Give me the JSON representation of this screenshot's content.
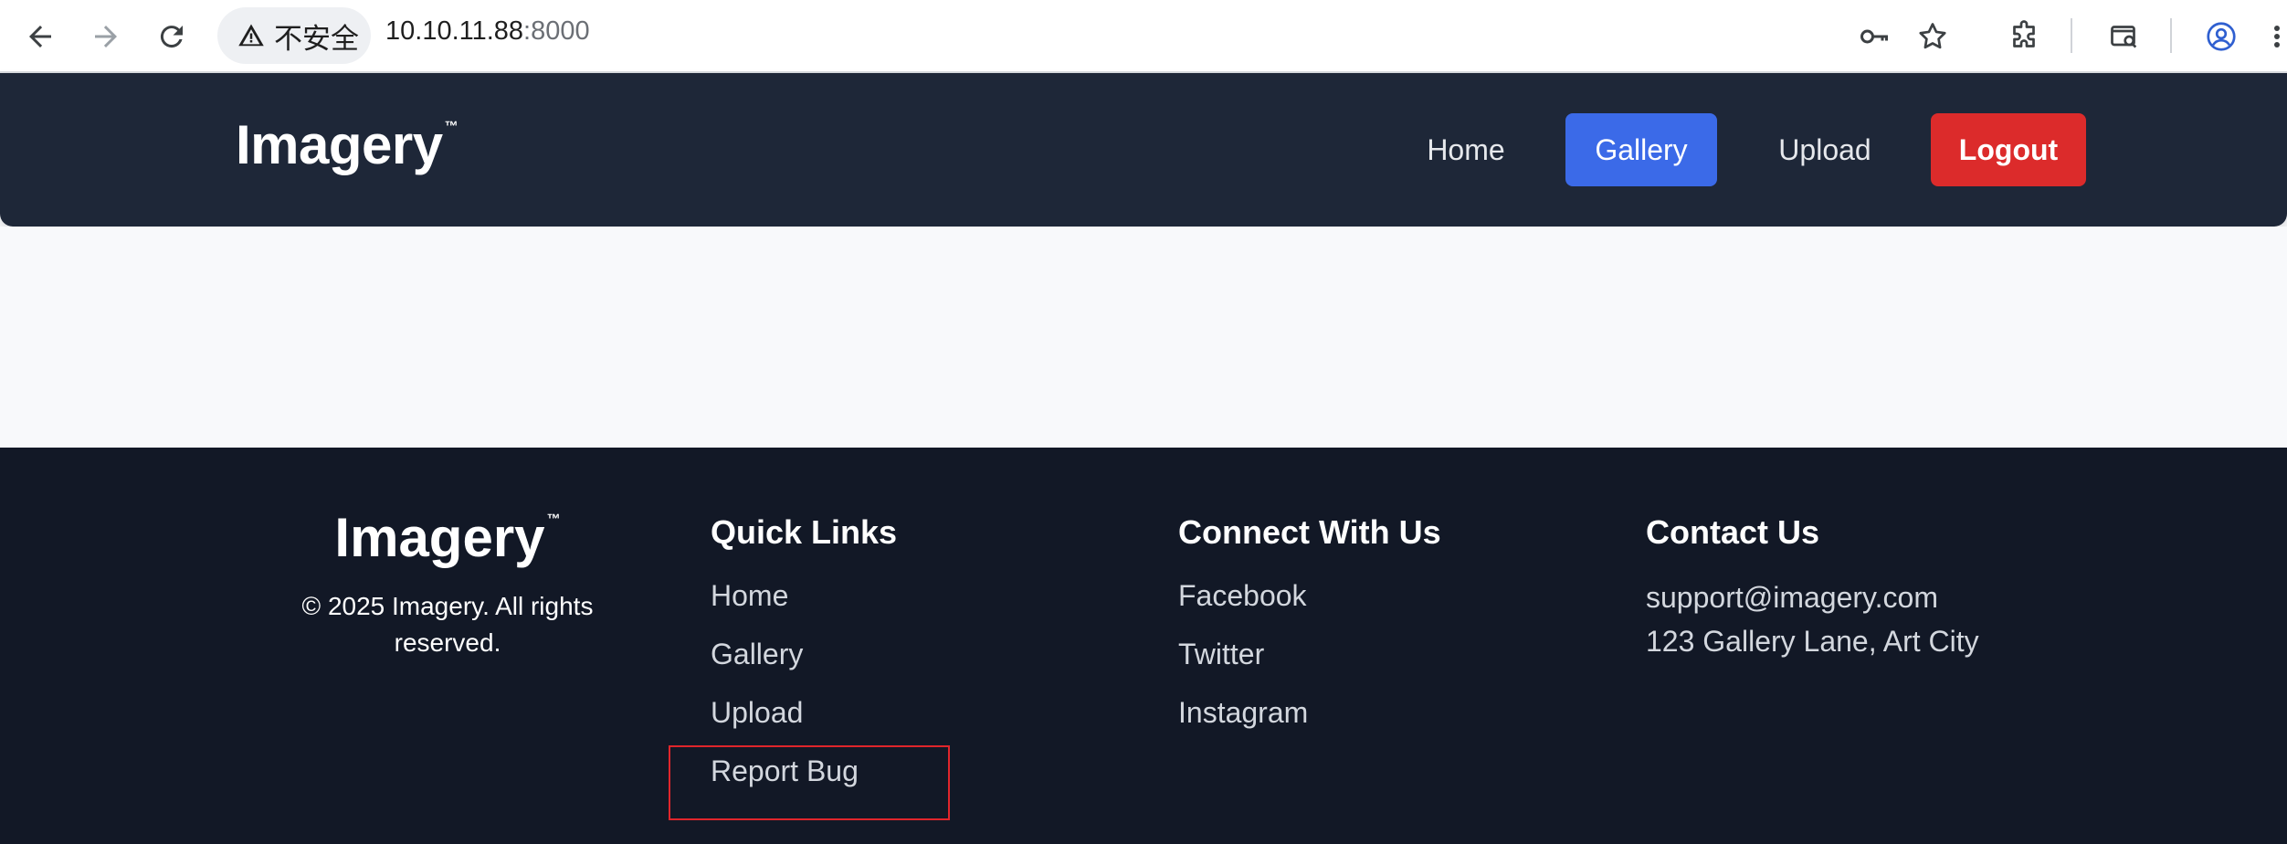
{
  "browser": {
    "security_label": "不安全",
    "url_host": "10.10.11.88",
    "url_port": ":8000"
  },
  "header": {
    "brand": "Imagery",
    "brand_mark": "™",
    "nav": {
      "home": "Home",
      "gallery": "Gallery",
      "upload": "Upload",
      "logout": "Logout"
    },
    "active_nav": "Gallery"
  },
  "footer": {
    "brand": "Imagery",
    "brand_mark": "™",
    "copyright": "© 2025 Imagery. All rights reserved.",
    "quick_links": {
      "heading": "Quick Links",
      "items": [
        "Home",
        "Gallery",
        "Upload",
        "Report Bug"
      ]
    },
    "connect": {
      "heading": "Connect With Us",
      "items": [
        "Facebook",
        "Twitter",
        "Instagram"
      ]
    },
    "contact": {
      "heading": "Contact Us",
      "email": "support@imagery.com",
      "address": "123 Gallery Lane, Art City"
    }
  },
  "colors": {
    "header_bg": "#1e2738",
    "footer_bg": "#121826",
    "active_nav": "#3b6ae8",
    "logout": "#dc2b2b",
    "highlight": "#e0252b"
  }
}
